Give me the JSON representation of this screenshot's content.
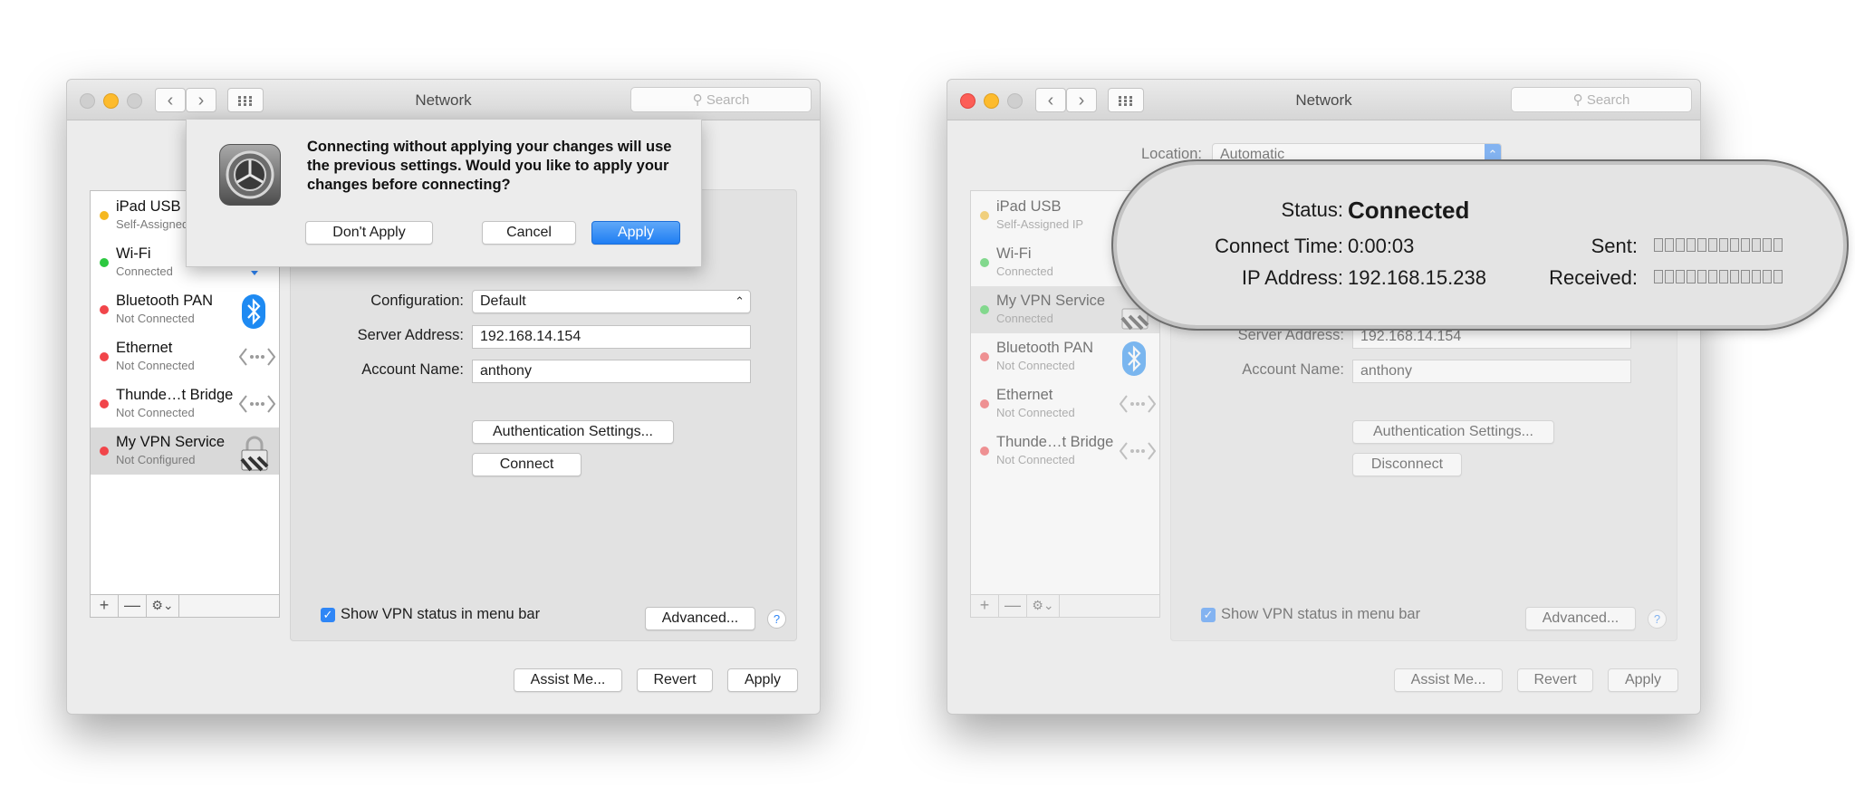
{
  "colors": {
    "close": "#fc5e57",
    "minimize": "#fdbb2d",
    "zoom": "#cbcbcb",
    "status_green": "#2cc840",
    "status_red": "#f1454a",
    "status_yellow": "#f5b821",
    "accent_blue": "#1f7ef3"
  },
  "left": {
    "window_title": "Network",
    "search_placeholder": "Search",
    "nav_back_icon": "chevron-left-icon",
    "nav_forward_icon": "chevron-right-icon",
    "services": [
      {
        "name": "iPad USB",
        "status": "Self-Assigned",
        "dot": "yellow",
        "icon": ""
      },
      {
        "name": "Wi-Fi",
        "status": "Connected",
        "dot": "green",
        "icon": "wifi-icon"
      },
      {
        "name": "Bluetooth PAN",
        "status": "Not Connected",
        "dot": "red",
        "icon": "bluetooth-icon"
      },
      {
        "name": "Ethernet",
        "status": "Not Connected",
        "dot": "red",
        "icon": "ethernet-icon"
      },
      {
        "name": "Thunde…t Bridge",
        "status": "Not Connected",
        "dot": "red",
        "icon": "thunderbolt-bridge-icon"
      },
      {
        "name": "My VPN Service",
        "status": "Not Configured",
        "dot": "red",
        "icon": "vpn-lock-icon"
      }
    ],
    "sidebar_footer": {
      "add": "+",
      "remove": "—",
      "gear": "⚙︎⌄"
    },
    "form": {
      "configuration_label": "Configuration:",
      "configuration_value": "Default",
      "server_label": "Server Address:",
      "server_value": "192.168.14.154",
      "account_label": "Account Name:",
      "account_value": "anthony",
      "auth_button": "Authentication Settings...",
      "connect_button": "Connect"
    },
    "show_vpn_status": "Show VPN status in menu bar",
    "show_vpn_checked": true,
    "advanced_button": "Advanced...",
    "help": "?",
    "assist_button": "Assist Me...",
    "revert_button": "Revert",
    "apply_button": "Apply",
    "dialog": {
      "message": "Connecting without applying your changes will use the previous settings. Would you like to apply your changes before connecting?",
      "dont_apply": "Don't Apply",
      "cancel": "Cancel",
      "apply": "Apply"
    }
  },
  "right": {
    "window_title": "Network",
    "search_placeholder": "Search",
    "location_label": "Location:",
    "location_value": "Automatic",
    "services": [
      {
        "name": "iPad USB",
        "status": "Self-Assigned IP",
        "dot": "yellow",
        "icon": ""
      },
      {
        "name": "Wi-Fi",
        "status": "Connected",
        "dot": "green",
        "icon": ""
      },
      {
        "name": "My VPN Service",
        "status": "Connected",
        "dot": "green",
        "icon": "vpn-lock-icon"
      },
      {
        "name": "Bluetooth PAN",
        "status": "Not Connected",
        "dot": "red",
        "icon": "bluetooth-icon"
      },
      {
        "name": "Ethernet",
        "status": "Not Connected",
        "dot": "red",
        "icon": "ethernet-icon"
      },
      {
        "name": "Thunde…t Bridge",
        "status": "Not Connected",
        "dot": "red",
        "icon": "thunderbolt-bridge-icon"
      }
    ],
    "sidebar_footer": {
      "add": "+",
      "remove": "—",
      "gear": "⚙︎⌄"
    },
    "form": {
      "server_label": "Server Address:",
      "server_value": "192.168.14.154",
      "account_label": "Account Name:",
      "account_value": "anthony",
      "auth_button": "Authentication Settings...",
      "disconnect_button": "Disconnect"
    },
    "show_vpn_status": "Show VPN status in menu bar",
    "show_vpn_checked": true,
    "advanced_button": "Advanced...",
    "help": "?",
    "assist_button": "Assist Me...",
    "revert_button": "Revert",
    "apply_button": "Apply",
    "status_zoom": {
      "status_label": "Status:",
      "status_value": "Connected",
      "connect_time_label": "Connect Time:",
      "connect_time_value": "0:00:03",
      "ip_label": "IP Address:",
      "ip_value": "192.168.15.238",
      "sent_label": "Sent:",
      "received_label": "Received:"
    }
  }
}
